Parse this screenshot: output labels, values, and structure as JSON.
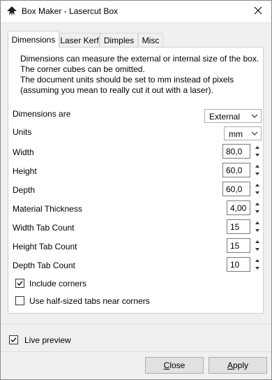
{
  "window": {
    "title": "Box Maker - Lasercut Box"
  },
  "tabs": [
    {
      "label": "Dimensions"
    },
    {
      "label": "Laser Kerf"
    },
    {
      "label": "Dimples"
    },
    {
      "label": "Misc"
    }
  ],
  "description": "Dimensions can measure the external or internal size of the box.\nThe corner cubes can be omitted.\nThe document units should be set to mm instead of pixels\n(assuming you mean to really cut it out with a laser).",
  "fields": {
    "dimensions_are": {
      "label": "Dimensions are",
      "value": "External"
    },
    "units": {
      "label": "Units",
      "value": "mm"
    },
    "width": {
      "label": "Width",
      "value": "80,0"
    },
    "height": {
      "label": "Height",
      "value": "60,0"
    },
    "depth": {
      "label": "Depth",
      "value": "60,0"
    },
    "material_thickness": {
      "label": "Material Thickness",
      "value": "4,00"
    },
    "width_tab_count": {
      "label": "Width Tab Count",
      "value": "15"
    },
    "height_tab_count": {
      "label": "Height Tab Count",
      "value": "15"
    },
    "depth_tab_count": {
      "label": "Depth Tab Count",
      "value": "10"
    }
  },
  "checkboxes": {
    "include_corners": {
      "label": "Include corners",
      "checked": true
    },
    "half_sized_tabs": {
      "label": "Use half-sized tabs near corners",
      "checked": false
    },
    "live_preview": {
      "label": "Live preview",
      "checked": true
    }
  },
  "buttons": {
    "close_prefix": "C",
    "close_rest": "lose",
    "apply_prefix": "A",
    "apply_rest": "pply"
  },
  "icons": {
    "app": "inkscape-icon",
    "close": "close-icon",
    "spin_up": "spin-up-icon",
    "spin_down": "spin-down-icon",
    "dropdown": "chevron-down-icon",
    "check": "check-icon"
  }
}
